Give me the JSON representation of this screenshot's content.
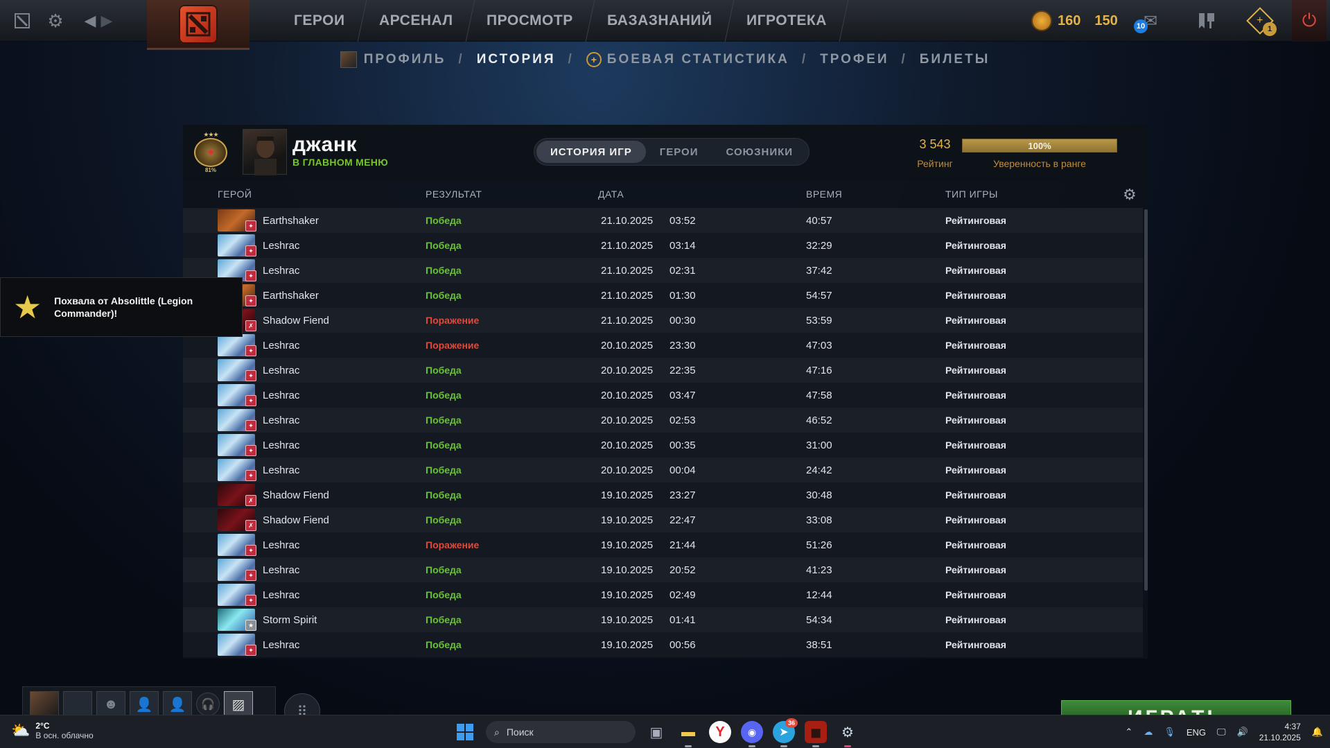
{
  "topnav": {
    "items": [
      "ГЕРОИ",
      "АРСЕНАЛ",
      "ПРОСМОТР",
      "БАЗАЗНАНИЙ",
      "ИГРОТЕКА"
    ],
    "shards": "160",
    "gold": "150",
    "mail_count": "10",
    "plus_count": "1"
  },
  "subnav": {
    "profile": "ПРОФИЛЬ",
    "history": "ИСТОРИЯ",
    "combat_stats": "БОЕВАЯ СТАТИСТИКА",
    "trophies": "ТРОФЕИ",
    "tickets": "БИЛЕТЫ",
    "separator": "/"
  },
  "player": {
    "name": "джанк",
    "status": "В ГЛАВНОМ МЕНЮ",
    "medal_pct": "81%",
    "rating_value": "3 543",
    "rating_label": "Рейтинг",
    "confidence_value": "100%",
    "confidence_fraction": 1.0,
    "confidence_label": "Уверенность в ранге"
  },
  "tabs": [
    "ИСТОРИЯ ИГР",
    "ГЕРОИ",
    "СОЮЗНИКИ"
  ],
  "columns": {
    "hero": "ГЕРОЙ",
    "result": "РЕЗУЛЬТАТ",
    "date": "ДАТА",
    "duration": "ВРЕМЯ",
    "type": "ТИП ИГРЫ"
  },
  "matches": [
    {
      "hero": "Earthshaker",
      "result": "Победа",
      "date": "21.10.2025",
      "time": "03:52",
      "duration": "40:57",
      "type": "Рейтинговая"
    },
    {
      "hero": "Leshrac",
      "result": "Победа",
      "date": "21.10.2025",
      "time": "03:14",
      "duration": "32:29",
      "type": "Рейтинговая"
    },
    {
      "hero": "Leshrac",
      "result": "Победа",
      "date": "21.10.2025",
      "time": "02:31",
      "duration": "37:42",
      "type": "Рейтинговая"
    },
    {
      "hero": "Earthshaker",
      "result": "Победа",
      "date": "21.10.2025",
      "time": "01:30",
      "duration": "54:57",
      "type": "Рейтинговая"
    },
    {
      "hero": "Shadow Fiend",
      "result": "Поражение",
      "date": "21.10.2025",
      "time": "00:30",
      "duration": "53:59",
      "type": "Рейтинговая"
    },
    {
      "hero": "Leshrac",
      "result": "Поражение",
      "date": "20.10.2025",
      "time": "23:30",
      "duration": "47:03",
      "type": "Рейтинговая"
    },
    {
      "hero": "Leshrac",
      "result": "Победа",
      "date": "20.10.2025",
      "time": "22:35",
      "duration": "47:16",
      "type": "Рейтинговая"
    },
    {
      "hero": "Leshrac",
      "result": "Победа",
      "date": "20.10.2025",
      "time": "03:47",
      "duration": "47:58",
      "type": "Рейтинговая"
    },
    {
      "hero": "Leshrac",
      "result": "Победа",
      "date": "20.10.2025",
      "time": "02:53",
      "duration": "46:52",
      "type": "Рейтинговая"
    },
    {
      "hero": "Leshrac",
      "result": "Победа",
      "date": "20.10.2025",
      "time": "00:35",
      "duration": "31:00",
      "type": "Рейтинговая"
    },
    {
      "hero": "Leshrac",
      "result": "Победа",
      "date": "20.10.2025",
      "time": "00:04",
      "duration": "24:42",
      "type": "Рейтинговая"
    },
    {
      "hero": "Shadow Fiend",
      "result": "Победа",
      "date": "19.10.2025",
      "time": "23:27",
      "duration": "30:48",
      "type": "Рейтинговая"
    },
    {
      "hero": "Shadow Fiend",
      "result": "Победа",
      "date": "19.10.2025",
      "time": "22:47",
      "duration": "33:08",
      "type": "Рейтинговая"
    },
    {
      "hero": "Leshrac",
      "result": "Поражение",
      "date": "19.10.2025",
      "time": "21:44",
      "duration": "51:26",
      "type": "Рейтинговая"
    },
    {
      "hero": "Leshrac",
      "result": "Победа",
      "date": "19.10.2025",
      "time": "20:52",
      "duration": "41:23",
      "type": "Рейтинговая"
    },
    {
      "hero": "Leshrac",
      "result": "Победа",
      "date": "19.10.2025",
      "time": "02:49",
      "duration": "12:44",
      "type": "Рейтинговая"
    },
    {
      "hero": "Storm Spirit",
      "result": "Победа",
      "date": "19.10.2025",
      "time": "01:41",
      "duration": "54:34",
      "type": "Рейтинговая"
    },
    {
      "hero": "Leshrac",
      "result": "Победа",
      "date": "19.10.2025",
      "time": "00:56",
      "duration": "38:51",
      "type": "Рейтинговая"
    }
  ],
  "colors": {
    "win": "#6cc13a",
    "loss": "#e04a3c",
    "gold": "#e3b34a",
    "status_green": "#77c42f"
  },
  "hero_styles": {
    "Earthshaker": "linear-gradient(135deg,#7a3b14,#c46a2a 50%,#3b1a0c)",
    "Leshrac": "linear-gradient(135deg,#5ea7d8,#c7e3f4 40%,#4a6fa8 70%,#e06aa0)",
    "Shadow Fiend": "linear-gradient(135deg,#2a0a0c,#7a121a 50%,#1a0406)",
    "Storm Spirit": "linear-gradient(135deg,#1b6e7a,#8ae8f0 45%,#2c5aa8)"
  },
  "notification": {
    "text": "Похвала от Absolittle (Legion Commander)!"
  },
  "play_button": "ИГРАТЬ",
  "taskbar": {
    "temp": "2°C",
    "weather": "В осн. облачно",
    "search_placeholder": "Поиск",
    "telegram_badge": "36",
    "lang": "ENG",
    "time": "4:37",
    "date": "21.10.2025"
  }
}
